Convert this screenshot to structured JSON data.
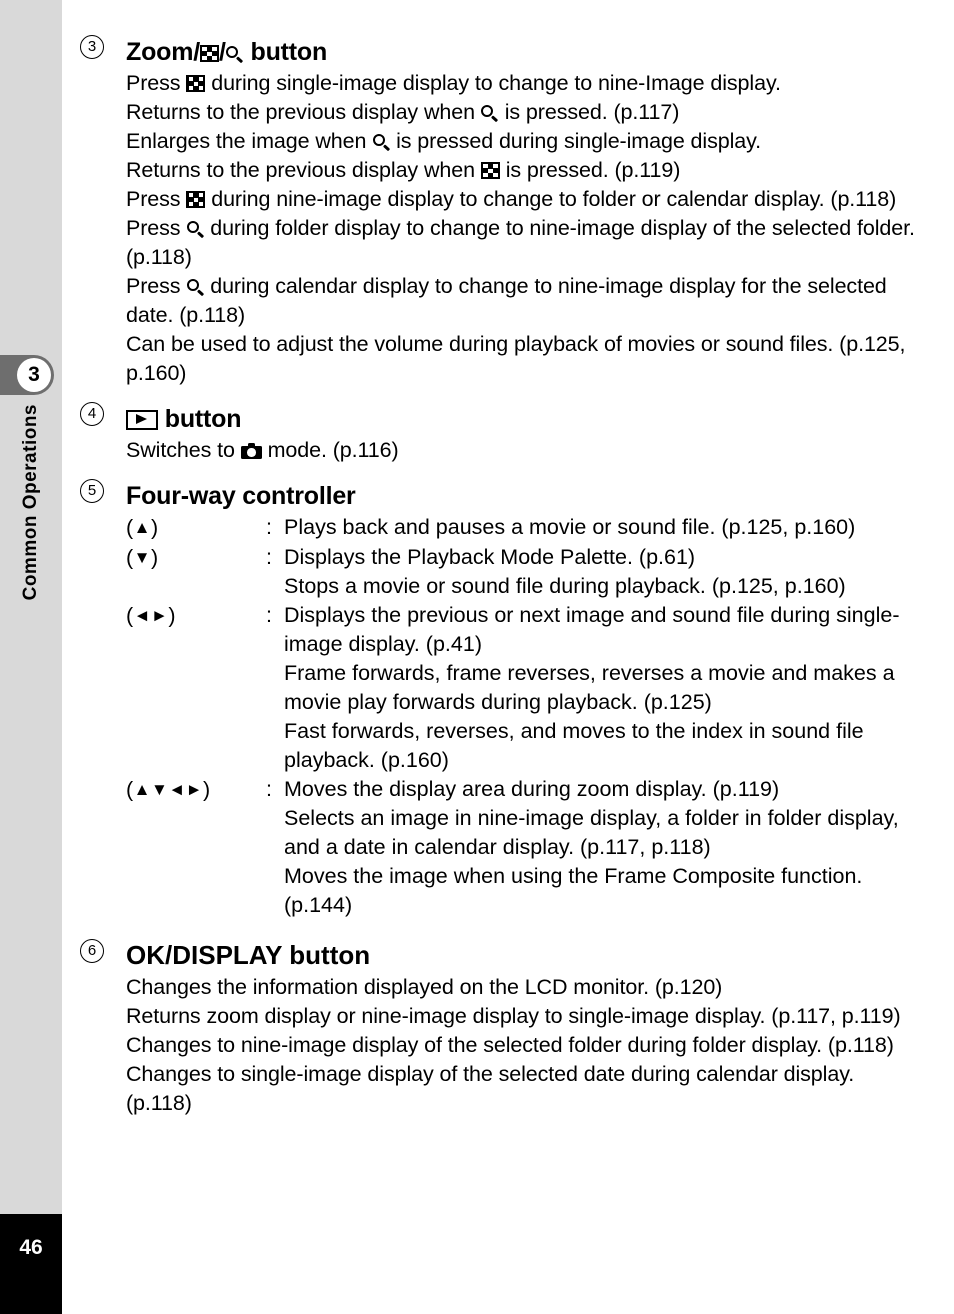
{
  "sidebar": {
    "chapter_number": "3",
    "chapter_title": "Common Operations",
    "page_number": "46"
  },
  "entries": [
    {
      "number": "3",
      "title_prefix": "Zoom/",
      "title_sep": "/",
      "title_suffix": " button",
      "icons": [
        "nine-image-icon",
        "magnifier-icon"
      ],
      "lines": [
        "Press ■ during single-image display to change to nine-Image display.",
        "Returns to the previous display when ■ is pressed. (p.117)",
        "Enlarges the image when ■ is pressed during single-image display.",
        "Returns to the previous display when ■ is pressed. (p.119)",
        "Press ■ during nine-image display to change to folder or calendar display. (p.118)",
        "Press ■ during folder display to change to nine-image display of the selected folder. (p.118)",
        "Press ■ during calendar display to change to nine-image display for the selected date. (p.118)",
        "Can be used to adjust the volume during playback of movies or sound files. (p.125, p.160)"
      ],
      "line_parts": {
        "l1_a": "Press ",
        "l1_b": " during single-image display to change to nine-Image display.",
        "l2_a": "Returns to the previous display when ",
        "l2_b": " is pressed. (p.117)",
        "l3_a": "Enlarges the image when ",
        "l3_b": " is pressed during single-image display.",
        "l4_a": "Returns to the previous display when ",
        "l4_b": " is pressed. (p.119)",
        "l5_a": "Press ",
        "l5_b": " during nine-image display to change to folder or calendar display. (p.118)",
        "l6_a": "Press ",
        "l6_b": " during folder display to change to nine-image display of the selected folder. (p.118)",
        "l7_a": "Press ",
        "l7_b": " during calendar display to change to nine-image display for the selected date. (p.118)",
        "l8": "Can be used to adjust the volume during playback of movies or sound files. (p.125, p.160)"
      }
    },
    {
      "number": "4",
      "title_suffix": " button",
      "icons": [
        "playback-mode-icon",
        "camera-mode-icon"
      ],
      "body_a": "Switches to ",
      "body_b": " mode. (p.116)"
    },
    {
      "number": "5",
      "title": "Four-way controller",
      "rows": [
        {
          "key_open": "(",
          "key_arrows": "▲",
          "key_close": ")",
          "colon": ":",
          "desc": "Plays back and pauses a movie or sound file. (p.125, p.160)"
        },
        {
          "key_open": "(",
          "key_arrows": "▼",
          "key_close": ")",
          "colon": ":",
          "desc_1": "Displays the Playback Mode Palette. (p.61)",
          "desc_2": "Stops a movie or sound file during playback. (p.125, p.160)"
        },
        {
          "key_open": "(",
          "key_arrows": "◄►",
          "key_close": ")",
          "colon": ":",
          "desc_1": "Displays the previous or next image and sound file during single-image display. (p.41)",
          "desc_2": "Frame forwards, frame reverses, reverses a movie and makes a movie play forwards during playback. (p.125)",
          "desc_3": "Fast forwards, reverses, and moves to the index in sound file playback. (p.160)"
        },
        {
          "key_open": "(",
          "key_arrows": "▲▼◄►",
          "key_close": ")",
          "colon": ":",
          "desc_1": "Moves the display area during zoom display. (p.119)",
          "desc_2": "Selects an image in nine-image display, a folder in folder display, and a date in calendar display. (p.117, p.118)",
          "desc_3": "Moves the image when using the Frame Composite function. (p.144)"
        }
      ]
    },
    {
      "number": "6",
      "title": "OK/DISPLAY",
      "title_suffix": " button",
      "lines": {
        "l1": "Changes the information displayed on the LCD monitor. (p.120)",
        "l2": "Returns zoom display or nine-image display to single-image display. (p.117, p.119)",
        "l3": "Changes to nine-image display of the selected folder during folder display. (p.118)",
        "l4": "Changes to single-image display of the selected date during calendar display. (p.118)"
      }
    }
  ],
  "colors": {
    "sidebar_bg": "#d9d9d9",
    "tab_bg": "#6e6e6e",
    "page_block_bg": "#000000",
    "text": "#000000"
  }
}
